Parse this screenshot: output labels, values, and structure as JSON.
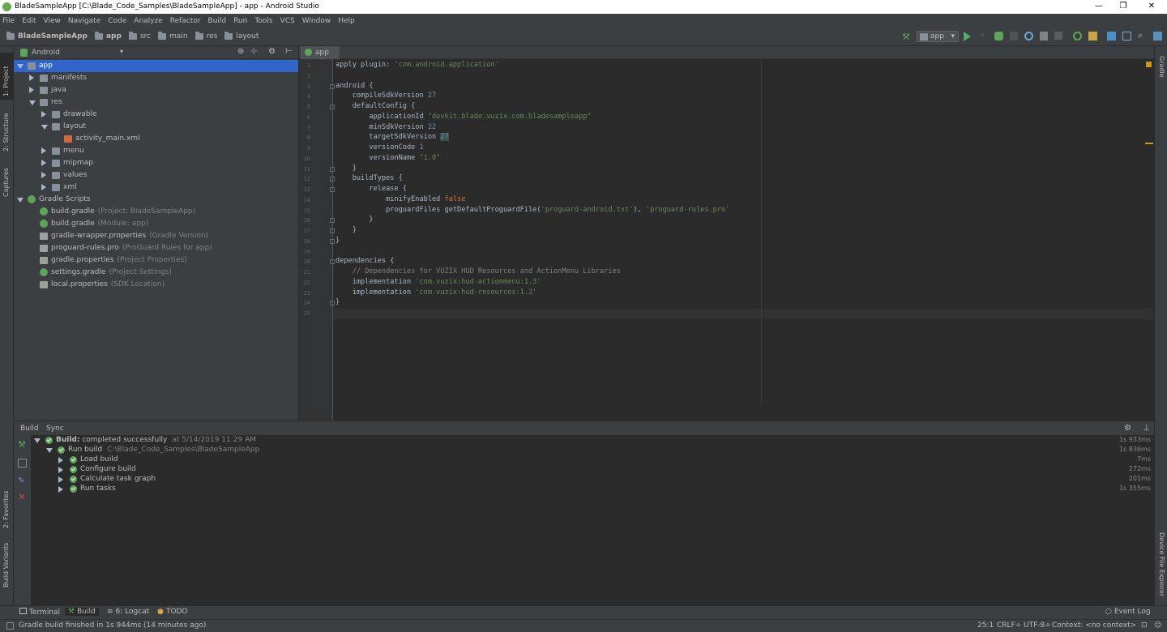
{
  "window": {
    "title": "BladeSampleApp [C:\\Blade_Code_Samples\\BladeSampleApp] - app - Android Studio",
    "minimize": "—",
    "restore": "❐",
    "close": "✕"
  },
  "menu": [
    "File",
    "Edit",
    "View",
    "Navigate",
    "Code",
    "Analyze",
    "Refactor",
    "Build",
    "Run",
    "Tools",
    "VCS",
    "Window",
    "Help"
  ],
  "breadcrumbs": [
    "BladeSampleApp",
    "app",
    "src",
    "main",
    "res",
    "layout"
  ],
  "toolbar": {
    "run_config": "app"
  },
  "left_strip": {
    "project": "1: Project",
    "structure": "2: Structure",
    "captures": "Captures",
    "favorites": "2: Favorites",
    "build_variants": "Build Variants"
  },
  "right_strip": {
    "gradle": "Gradle",
    "device_file_explorer": "Device File Explorer"
  },
  "project": {
    "view_mode": "Android",
    "tree": [
      {
        "label": "app",
        "suffix": "",
        "indent": 0,
        "expanded": true,
        "icon": "folder",
        "selected": true
      },
      {
        "label": "manifests",
        "suffix": "",
        "indent": 1,
        "expanded": false,
        "icon": "folder"
      },
      {
        "label": "java",
        "suffix": "",
        "indent": 1,
        "expanded": false,
        "icon": "folder"
      },
      {
        "label": "res",
        "suffix": "",
        "indent": 1,
        "expanded": true,
        "icon": "folder"
      },
      {
        "label": "drawable",
        "suffix": "",
        "indent": 2,
        "expanded": false,
        "icon": "folder"
      },
      {
        "label": "layout",
        "suffix": "",
        "indent": 2,
        "expanded": true,
        "icon": "folder"
      },
      {
        "label": "activity_main.xml",
        "suffix": "",
        "indent": 3,
        "leaf": true,
        "icon": "xml"
      },
      {
        "label": "menu",
        "suffix": "",
        "indent": 2,
        "expanded": false,
        "icon": "folder"
      },
      {
        "label": "mipmap",
        "suffix": "",
        "indent": 2,
        "expanded": false,
        "icon": "folder"
      },
      {
        "label": "values",
        "suffix": "",
        "indent": 2,
        "expanded": false,
        "icon": "folder"
      },
      {
        "label": "xml",
        "suffix": "",
        "indent": 2,
        "expanded": false,
        "icon": "folder"
      },
      {
        "label": "Gradle Scripts",
        "suffix": "",
        "indent": 0,
        "expanded": true,
        "icon": "gradle"
      },
      {
        "label": "build.gradle",
        "suffix": "(Project: BladeSampleApp)",
        "indent": 1,
        "leaf": true,
        "icon": "gradle"
      },
      {
        "label": "build.gradle",
        "suffix": "(Module: app)",
        "indent": 1,
        "leaf": true,
        "icon": "gradle"
      },
      {
        "label": "gradle-wrapper.properties",
        "suffix": "(Gradle Version)",
        "indent": 1,
        "leaf": true,
        "icon": "prop"
      },
      {
        "label": "proguard-rules.pro",
        "suffix": "(ProGuard Rules for app)",
        "indent": 1,
        "leaf": true,
        "icon": "prop"
      },
      {
        "label": "gradle.properties",
        "suffix": "(Project Properties)",
        "indent": 1,
        "leaf": true,
        "icon": "prop"
      },
      {
        "label": "settings.gradle",
        "suffix": "(Project Settings)",
        "indent": 1,
        "leaf": true,
        "icon": "gradle"
      },
      {
        "label": "local.properties",
        "suffix": "(SDK Location)",
        "indent": 1,
        "leaf": true,
        "icon": "prop"
      }
    ]
  },
  "editor": {
    "tab": "app",
    "lines": [
      [
        [
          "apply plugin: ",
          ""
        ],
        [
          "'com.android.application'",
          "str"
        ]
      ],
      [],
      [
        [
          "android {",
          ""
        ]
      ],
      [
        [
          "    compileSdkVersion ",
          ""
        ],
        [
          "27",
          "num"
        ]
      ],
      [
        [
          "    defaultConfig {",
          ""
        ]
      ],
      [
        [
          "        applicationId ",
          ""
        ],
        [
          "\"devkit.blade.vuzix.com.bladesampleapp\"",
          "str"
        ]
      ],
      [
        [
          "        minSdkVersion ",
          ""
        ],
        [
          "22",
          "num"
        ]
      ],
      [
        [
          "        targetSdkVersion ",
          ""
        ],
        [
          "27",
          "num hl"
        ]
      ],
      [
        [
          "        versionCode ",
          ""
        ],
        [
          "1",
          "num"
        ]
      ],
      [
        [
          "        versionName ",
          ""
        ],
        [
          "\"1.0\"",
          "str"
        ]
      ],
      [
        [
          "    }",
          ""
        ]
      ],
      [
        [
          "    buildTypes {",
          ""
        ]
      ],
      [
        [
          "        release {",
          ""
        ]
      ],
      [
        [
          "            minifyEnabled ",
          ""
        ],
        [
          "false",
          "kw"
        ]
      ],
      [
        [
          "            proguardFiles getDefaultProguardFile(",
          ""
        ],
        [
          "'proguard-android.txt'",
          "str"
        ],
        [
          "), ",
          ""
        ],
        [
          "'proguard-rules.pro'",
          "str"
        ]
      ],
      [
        [
          "        }",
          ""
        ]
      ],
      [
        [
          "    }",
          ""
        ]
      ],
      [
        [
          "}",
          ""
        ]
      ],
      [],
      [
        [
          "dependencies {",
          ""
        ]
      ],
      [
        [
          "    // Dependencies for VUZIX HUD Resources and ActionMenu Libraries",
          "cm"
        ]
      ],
      [
        [
          "    implementation ",
          ""
        ],
        [
          "'com.vuzix:hud-actionmenu:1.3'",
          "str"
        ]
      ],
      [
        [
          "    implementation ",
          ""
        ],
        [
          "'com.vuzix:hud-resources:1.2'",
          "str"
        ]
      ],
      [
        [
          "}",
          ""
        ]
      ],
      []
    ]
  },
  "build": {
    "tabs": [
      "Build",
      "Sync"
    ],
    "rows": [
      {
        "label": "Build:",
        "text": " completed successfully",
        "detail": "at 5/14/2019 11:29 AM",
        "indent": 0,
        "duration": "1s 933ms"
      },
      {
        "label": "Run build",
        "text": "",
        "detail": "C:\\Blade_Code_Samples\\BladeSampleApp",
        "indent": 1,
        "duration": "1s 836ms"
      },
      {
        "label": "Load build",
        "text": "",
        "detail": "",
        "indent": 2,
        "duration": "7ms"
      },
      {
        "label": "Configure build",
        "text": "",
        "detail": "",
        "indent": 2,
        "duration": "272ms"
      },
      {
        "label": "Calculate task graph",
        "text": "",
        "detail": "",
        "indent": 2,
        "duration": "201ms"
      },
      {
        "label": "Run tasks",
        "text": "",
        "detail": "",
        "indent": 2,
        "duration": "1s 355ms"
      }
    ]
  },
  "tool_windows": {
    "terminal": "Terminal",
    "build": "Build",
    "logcat": "6: Logcat",
    "todo": "TODO",
    "event_log": "Event Log"
  },
  "status": {
    "message": "Gradle build finished in 1s 944ms (14 minutes ago)",
    "position": "25:1",
    "line_sep": "CRLF÷",
    "encoding": "UTF-8÷",
    "context": "Context: <no context>"
  }
}
